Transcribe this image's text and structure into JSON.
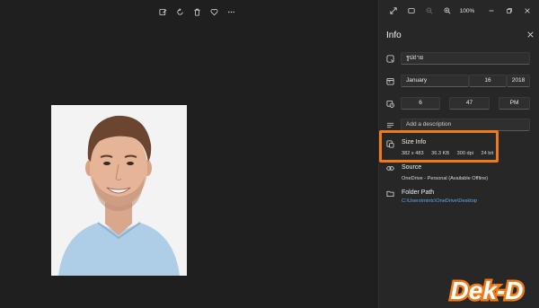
{
  "toolbar": {
    "icons": [
      "edit-icon",
      "rotate-icon",
      "delete-icon",
      "favorite-icon",
      "more-icon"
    ]
  },
  "panel": {
    "zoom_label": "100%",
    "title": "Info",
    "name_value": "รูปถ่าย",
    "date": {
      "month": "January",
      "day": "16",
      "year": "2018"
    },
    "time": {
      "hour": "6",
      "minute": "47",
      "ampm": "PM"
    },
    "description_placeholder": "Add a description",
    "size_info": {
      "title": "Size Info",
      "dimensions": "382 x 483",
      "file_size": "36.3 KB",
      "dpi": "300 dpi",
      "bit_depth": "24 bit"
    },
    "source": {
      "title": "Source",
      "value": "OneDrive - Personal (Available Offline)"
    },
    "folder_path": {
      "title": "Folder Path",
      "value": "C:\\Users\\mintc\\OneDrive\\Desktop"
    }
  },
  "colors": {
    "highlight": "#f07a18",
    "link": "#5ea9f2",
    "logo": "#f07a18"
  },
  "logo": {
    "text": "Dek-D"
  }
}
